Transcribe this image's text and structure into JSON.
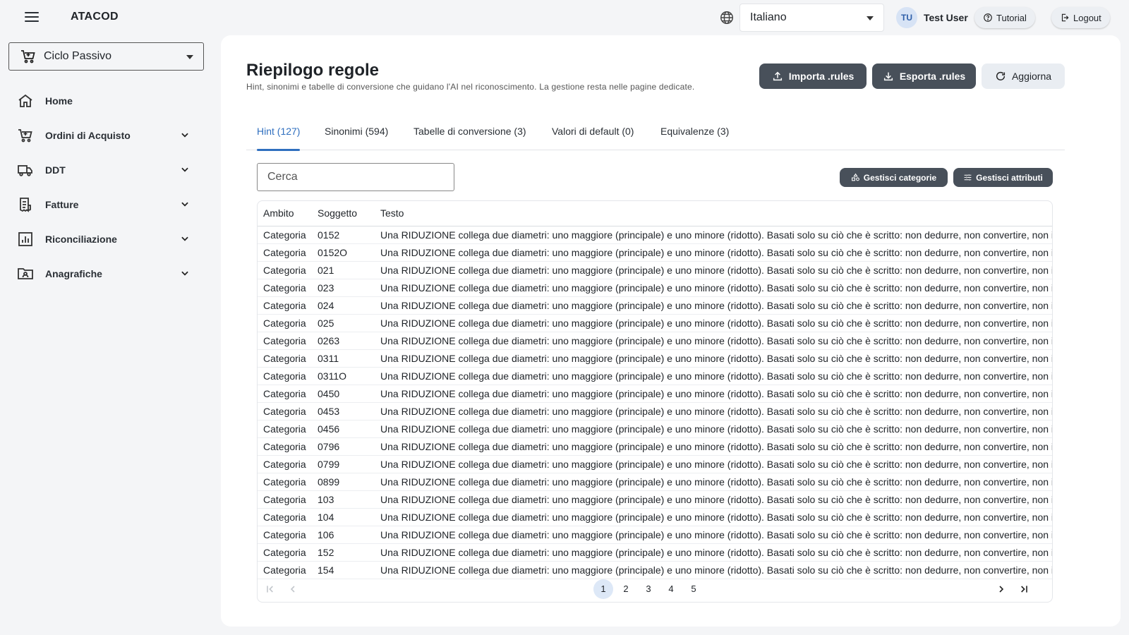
{
  "app": {
    "title": "ATACOD"
  },
  "header": {
    "language": "Italiano",
    "user_initials": "TU",
    "user_name": "Test User",
    "tutorial_label": "Tutorial",
    "logout_label": "Logout"
  },
  "sidebar": {
    "module": "Ciclo Passivo",
    "items": [
      {
        "label": "Home",
        "icon": "home-icon"
      },
      {
        "label": "Ordini di Acquisto",
        "icon": "cart-icon"
      },
      {
        "label": "DDT",
        "icon": "truck-icon"
      },
      {
        "label": "Fatture",
        "icon": "receipt-icon"
      },
      {
        "label": "Riconciliazione",
        "icon": "chart-icon"
      },
      {
        "label": "Anagrafiche",
        "icon": "folder-user-icon"
      }
    ]
  },
  "page": {
    "title": "Riepilogo regole",
    "subtitle": "Hint, sinonimi e tabelle di conversione che guidano l'AI nel riconoscimento. La gestione resta nelle pagine dedicate.",
    "import_label": "Importa .rules",
    "export_label": "Esporta .rules",
    "refresh_label": "Aggiorna",
    "tabs": [
      "Hint (127)",
      "Sinonimi (594)",
      "Tabelle di conversione (3)",
      "Valori di default (0)",
      "Equivalenze (3)"
    ],
    "active_tab": 0,
    "search_placeholder": "Cerca",
    "manage_categories_label": "Gestisci categorie",
    "manage_attributes_label": "Gestisci attributi"
  },
  "table": {
    "headers": [
      "Ambito",
      "Soggetto",
      "Testo"
    ],
    "rows": [
      [
        "Categoria",
        "0152",
        "Una RIDUZIONE collega due diametri: uno maggiore (principale) e uno minore (ridotto). Basati solo su ciò che è scritto: non dedurre, non convertire, non ir"
      ],
      [
        "Categoria",
        "0152O",
        "Una RIDUZIONE collega due diametri: uno maggiore (principale) e uno minore (ridotto). Basati solo su ciò che è scritto: non dedurre, non convertire, non ir"
      ],
      [
        "Categoria",
        "021",
        "Una RIDUZIONE collega due diametri: uno maggiore (principale) e uno minore (ridotto). Basati solo su ciò che è scritto: non dedurre, non convertire, non ir"
      ],
      [
        "Categoria",
        "023",
        "Una RIDUZIONE collega due diametri: uno maggiore (principale) e uno minore (ridotto). Basati solo su ciò che è scritto: non dedurre, non convertire, non ir"
      ],
      [
        "Categoria",
        "024",
        "Una RIDUZIONE collega due diametri: uno maggiore (principale) e uno minore (ridotto). Basati solo su ciò che è scritto: non dedurre, non convertire, non ir"
      ],
      [
        "Categoria",
        "025",
        "Una RIDUZIONE collega due diametri: uno maggiore (principale) e uno minore (ridotto). Basati solo su ciò che è scritto: non dedurre, non convertire, non ir"
      ],
      [
        "Categoria",
        "0263",
        "Una RIDUZIONE collega due diametri: uno maggiore (principale) e uno minore (ridotto). Basati solo su ciò che è scritto: non dedurre, non convertire, non ir"
      ],
      [
        "Categoria",
        "0311",
        "Una RIDUZIONE collega due diametri: uno maggiore (principale) e uno minore (ridotto). Basati solo su ciò che è scritto: non dedurre, non convertire, non ir"
      ],
      [
        "Categoria",
        "0311O",
        "Una RIDUZIONE collega due diametri: uno maggiore (principale) e uno minore (ridotto). Basati solo su ciò che è scritto: non dedurre, non convertire, non ir"
      ],
      [
        "Categoria",
        "0450",
        "Una RIDUZIONE collega due diametri: uno maggiore (principale) e uno minore (ridotto). Basati solo su ciò che è scritto: non dedurre, non convertire, non ir"
      ],
      [
        "Categoria",
        "0453",
        "Una RIDUZIONE collega due diametri: uno maggiore (principale) e uno minore (ridotto). Basati solo su ciò che è scritto: non dedurre, non convertire, non ir"
      ],
      [
        "Categoria",
        "0456",
        "Una RIDUZIONE collega due diametri: uno maggiore (principale) e uno minore (ridotto). Basati solo su ciò che è scritto: non dedurre, non convertire, non ir"
      ],
      [
        "Categoria",
        "0796",
        "Una RIDUZIONE collega due diametri: uno maggiore (principale) e uno minore (ridotto). Basati solo su ciò che è scritto: non dedurre, non convertire, non ir"
      ],
      [
        "Categoria",
        "0799",
        "Una RIDUZIONE collega due diametri: uno maggiore (principale) e uno minore (ridotto). Basati solo su ciò che è scritto: non dedurre, non convertire, non ir"
      ],
      [
        "Categoria",
        "0899",
        "Una RIDUZIONE collega due diametri: uno maggiore (principale) e uno minore (ridotto). Basati solo su ciò che è scritto: non dedurre, non convertire, non ir"
      ],
      [
        "Categoria",
        "103",
        "Una RIDUZIONE collega due diametri: uno maggiore (principale) e uno minore (ridotto). Basati solo su ciò che è scritto: non dedurre, non convertire, non ir"
      ],
      [
        "Categoria",
        "104",
        "Una RIDUZIONE collega due diametri: uno maggiore (principale) e uno minore (ridotto). Basati solo su ciò che è scritto: non dedurre, non convertire, non ir"
      ],
      [
        "Categoria",
        "106",
        "Una RIDUZIONE collega due diametri: uno maggiore (principale) e uno minore (ridotto). Basati solo su ciò che è scritto: non dedurre, non convertire, non ir"
      ],
      [
        "Categoria",
        "152",
        "Una RIDUZIONE collega due diametri: uno maggiore (principale) e uno minore (ridotto). Basati solo su ciò che è scritto: non dedurre, non convertire, non ir"
      ],
      [
        "Categoria",
        "154",
        "Una RIDUZIONE collega due diametri: uno maggiore (principale) e uno minore (ridotto). Basati solo su ciò che è scritto: non dedurre, non convertire, non ir"
      ]
    ]
  },
  "pagination": {
    "pages": [
      "1",
      "2",
      "3",
      "4",
      "5"
    ],
    "current": 1
  },
  "colors": {
    "accent": "#2f6fbf",
    "dark_button": "#48505a",
    "background": "#f4f5f7"
  }
}
